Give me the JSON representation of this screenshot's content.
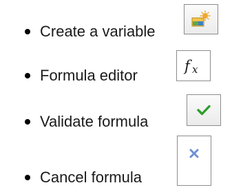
{
  "items": [
    {
      "label": "Create a variable",
      "icon": "create-variable-icon"
    },
    {
      "label": "Formula editor",
      "icon": "formula-fx-icon"
    },
    {
      "label": "Validate formula",
      "icon": "checkmark-icon"
    },
    {
      "label": "Cancel formula",
      "icon": "cancel-x-icon"
    }
  ],
  "colors": {
    "check_green": "#2e9e2e",
    "cancel_blue": "#6f8fd6",
    "icon_border": "#8c8c8c"
  }
}
